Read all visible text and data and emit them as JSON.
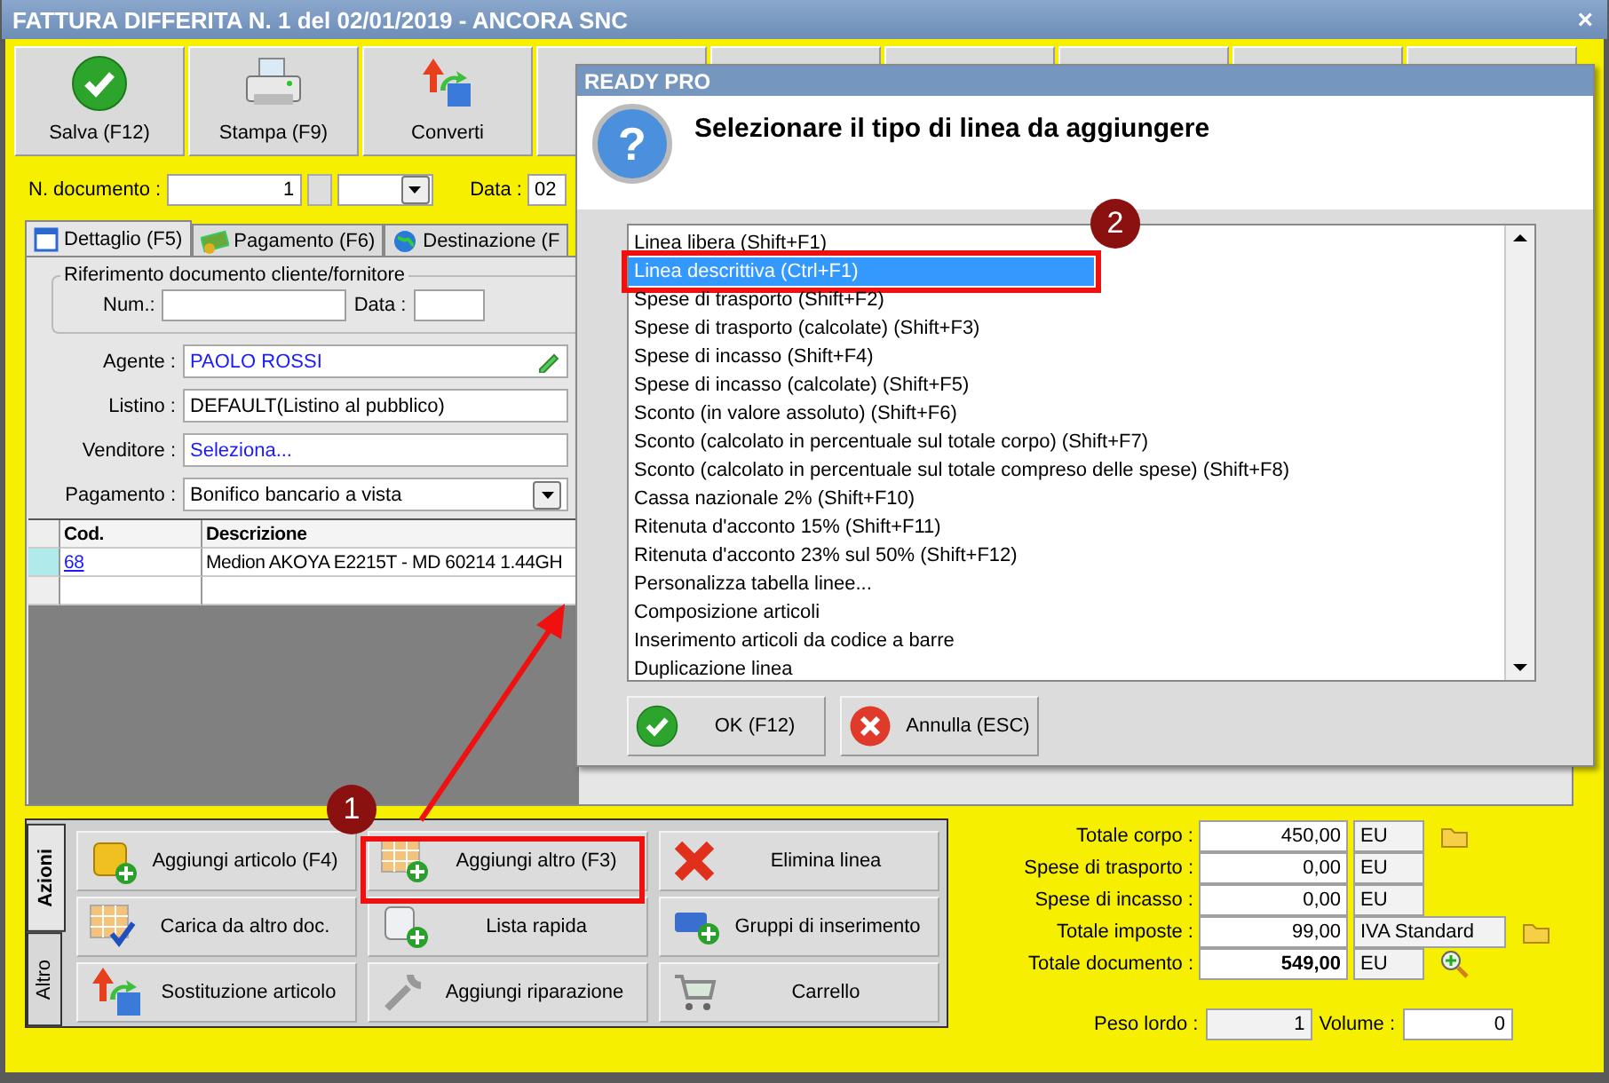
{
  "window": {
    "title": "FATTURA DIFFERITA N. 1 del 02/01/2019 - ANCORA SNC",
    "close": "×"
  },
  "toolbar": [
    {
      "label": "Salva (F12)",
      "kind": "check"
    },
    {
      "label": "Stampa (F9)",
      "kind": "printer"
    },
    {
      "label": "Converti",
      "kind": "convert"
    }
  ],
  "doc_row": {
    "number_label": "N. documento :",
    "number": "1",
    "date_label": "Data :",
    "date": "02"
  },
  "tabs": [
    {
      "label": "Dettaglio (F5)",
      "selected": true,
      "kind": "calendar"
    },
    {
      "label": "Pagamento (F6)",
      "selected": false,
      "kind": "money"
    },
    {
      "label": "Destinazione (F",
      "selected": false,
      "kind": "globe"
    }
  ],
  "reference": {
    "title": "Riferimento documento cliente/fornitore",
    "num_label": "Num.:",
    "date_label": "Data :"
  },
  "fields": [
    {
      "label": "Agente :",
      "value": "PAOLO ROSSI",
      "kind": "edit"
    },
    {
      "label": "Listino :",
      "value": "DEFAULT(Listino al pubblico)",
      "kind": "text"
    },
    {
      "label": "Venditore :",
      "value": "Seleziona...",
      "kind": "link"
    },
    {
      "label": "Pagamento :",
      "value": "Bonifico bancario a vista",
      "kind": "select"
    }
  ],
  "grid": {
    "columns": [
      "Cod.",
      "Descrizione"
    ],
    "rows": [
      {
        "code": "68",
        "description": "Medion AKOYA E2215T - MD 60214 1.44GH"
      }
    ]
  },
  "actions": {
    "side_tabs": [
      {
        "label": "Azioni",
        "selected": true
      },
      {
        "label": "Altro",
        "selected": false
      }
    ],
    "buttons": [
      {
        "label": "Aggiungi articolo (F4)",
        "kind": "box-plus"
      },
      {
        "label": "Aggiungi altro (F3)",
        "kind": "grid-plus"
      },
      {
        "label": "Elimina linea",
        "kind": "x"
      },
      {
        "label": "Carica da altro doc.",
        "kind": "grid-check"
      },
      {
        "label": "Lista rapida",
        "kind": "scroll-plus"
      },
      {
        "label": "Gruppi di inserimento",
        "kind": "rect-plus"
      },
      {
        "label": "Sostituzione articolo",
        "kind": "convert"
      },
      {
        "label": "Aggiungi riparazione",
        "kind": "wrench"
      },
      {
        "label": "Carrello",
        "kind": "cart"
      }
    ]
  },
  "totals": [
    {
      "label": "Totale corpo :",
      "value": "450,00",
      "unit": "EU",
      "bold": false,
      "kind": "folder"
    },
    {
      "label": "Spese di trasporto :",
      "value": "0,00",
      "unit": "EU",
      "bold": false,
      "kind": "plain"
    },
    {
      "label": "Spese di incasso :",
      "value": "0,00",
      "unit": "EU",
      "bold": false,
      "kind": "plain"
    },
    {
      "label": "Totale imposte :",
      "value": "99,00",
      "unit": "IVA Standard",
      "bold": false,
      "kind": "folder"
    },
    {
      "label": "Totale documento :",
      "value": "549,00",
      "unit": "EU",
      "bold": true,
      "kind": "zoom"
    }
  ],
  "weights": {
    "weight_label": "Peso lordo :",
    "weight": "1",
    "volume_label": "Volume :",
    "volume": "0"
  },
  "dialog": {
    "title": "READY PRO",
    "question_mark": "?",
    "heading": "Selezionare il tipo di linea da aggiungere",
    "items": [
      {
        "label": "Linea libera (Shift+F1)",
        "selected": false,
        "highlighted": false
      },
      {
        "label": "Linea descrittiva (Ctrl+F1)",
        "selected": true,
        "highlighted": true
      },
      {
        "label": "Spese di trasporto (Shift+F2)",
        "selected": false,
        "highlighted": false
      },
      {
        "label": "Spese di trasporto (calcolate) (Shift+F3)",
        "selected": false,
        "highlighted": false
      },
      {
        "label": "Spese di incasso (Shift+F4)",
        "selected": false,
        "highlighted": false
      },
      {
        "label": "Spese di incasso (calcolate) (Shift+F5)",
        "selected": false,
        "highlighted": false
      },
      {
        "label": "Sconto (in valore assoluto) (Shift+F6)",
        "selected": false,
        "highlighted": false
      },
      {
        "label": "Sconto (calcolato in percentuale sul totale corpo) (Shift+F7)",
        "selected": false,
        "highlighted": false
      },
      {
        "label": "Sconto (calcolato in percentuale sul totale compreso delle spese) (Shift+F8)",
        "selected": false,
        "highlighted": false
      },
      {
        "label": "Cassa nazionale 2% (Shift+F10)",
        "selected": false,
        "highlighted": false
      },
      {
        "label": "Ritenuta d'acconto 15% (Shift+F11)",
        "selected": false,
        "highlighted": false
      },
      {
        "label": "Ritenuta d'acconto 23% sul 50% (Shift+F12)",
        "selected": false,
        "highlighted": false
      },
      {
        "label": "Personalizza tabella linee...",
        "selected": false,
        "highlighted": false
      },
      {
        "label": "Composizione articoli",
        "selected": false,
        "highlighted": false
      },
      {
        "label": "Inserimento articoli da codice a barre",
        "selected": false,
        "highlighted": false
      },
      {
        "label": "Duplicazione linea",
        "selected": false,
        "highlighted": false
      }
    ],
    "buttons": [
      {
        "label": "OK (F12)",
        "kind": "ok"
      },
      {
        "label": "Annulla (ESC)",
        "kind": "cancel"
      }
    ]
  },
  "markers": [
    {
      "number": "1"
    },
    {
      "number": "2"
    }
  ]
}
